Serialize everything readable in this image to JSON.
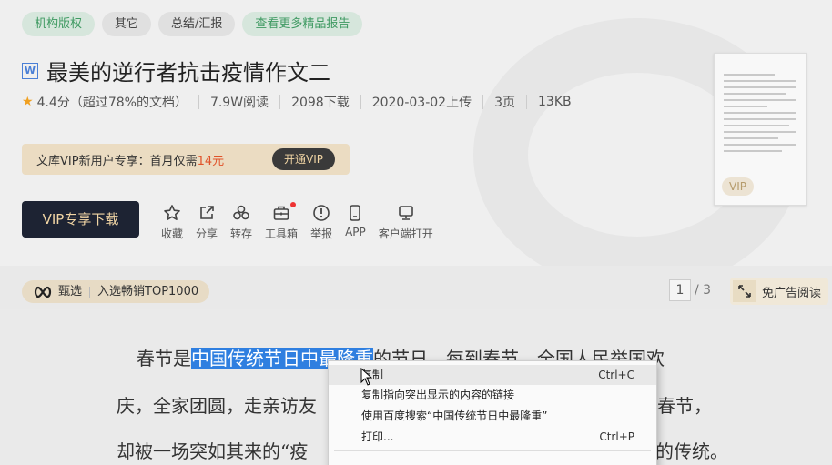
{
  "tags": [
    "机构版权",
    "其它",
    "总结/汇报",
    "查看更多精品报告"
  ],
  "doc": {
    "title": "最美的逆行者抗击疫情作文二",
    "rating": "4.4分（超过78%的文档）",
    "reads": "7.9W阅读",
    "downloads": "2098下载",
    "date": "2020-03-02上传",
    "pages": "3页",
    "size": "13KB"
  },
  "vip_banner": {
    "text": "文库VIP新用户专享：首月仅需",
    "price": "14元",
    "button": "开通VIP"
  },
  "download_button": "VIP专享下载",
  "tools": [
    {
      "label": "收藏",
      "icon": "star-icon"
    },
    {
      "label": "分享",
      "icon": "share-icon"
    },
    {
      "label": "转存",
      "icon": "transfer-icon"
    },
    {
      "label": "工具箱",
      "icon": "toolbox-icon"
    },
    {
      "label": "举报",
      "icon": "report-icon"
    },
    {
      "label": "APP",
      "icon": "phone-icon"
    },
    {
      "label": "客户端打开",
      "icon": "monitor-icon"
    }
  ],
  "thumbnail_badge": "VIP",
  "pick": {
    "label": "甄选",
    "text": "入选畅销TOP1000"
  },
  "pager": {
    "current": "1",
    "total": "/ 3"
  },
  "noad": "免广告阅读",
  "content": {
    "line1_pre": "春节是",
    "line1_sel": "中国传统节日中最隆重",
    "line1_post": "的节日，每到春节，全国人民举国欢",
    "line2": "庆，全家团圆，走亲访友",
    "line2_end": "春节，",
    "line3": "却被一场突如其来的“疫",
    "line3_end": "的传统。"
  },
  "context_menu": {
    "copy": "复制",
    "copy_sc": "Ctrl+C",
    "copy_link": "复制指向突出显示的内容的链接",
    "search": "使用百度搜索“中国传统节日中最隆重”",
    "print": "打印...",
    "print_sc": "Ctrl+P"
  }
}
